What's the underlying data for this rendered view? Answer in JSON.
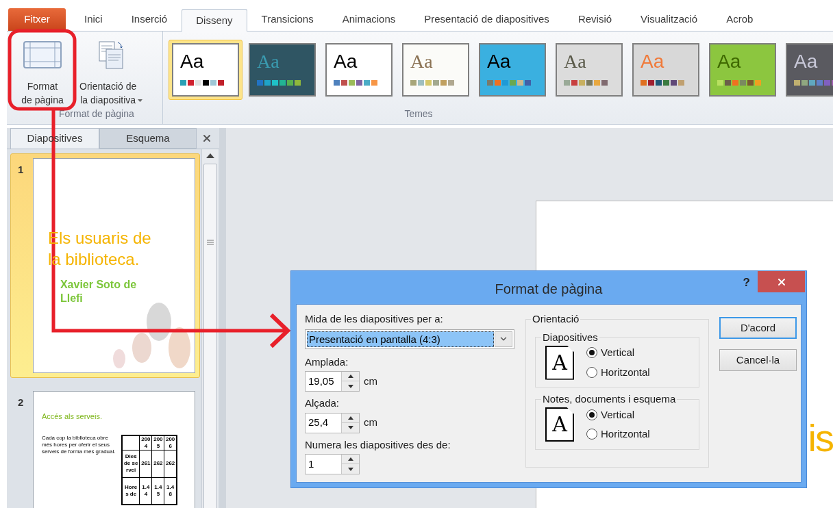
{
  "tabs": [
    {
      "label": "Fitxer",
      "kind": "file",
      "selected": false
    },
    {
      "label": "Inici",
      "kind": "tab",
      "selected": false
    },
    {
      "label": "Inserció",
      "kind": "tab",
      "selected": false
    },
    {
      "label": "Disseny",
      "kind": "tab",
      "selected": true
    },
    {
      "label": "Transicions",
      "kind": "tab",
      "selected": false
    },
    {
      "label": "Animacions",
      "kind": "tab",
      "selected": false
    },
    {
      "label": "Presentació de diapositives",
      "kind": "tab",
      "selected": false
    },
    {
      "label": "Revisió",
      "kind": "tab",
      "selected": false
    },
    {
      "label": "Visualització",
      "kind": "tab",
      "selected": false
    },
    {
      "label": "Acrob",
      "kind": "tab",
      "selected": false
    }
  ],
  "ribbon": {
    "page_group": {
      "label": "Format de pàgina",
      "buttons": [
        {
          "kind": "page",
          "lines": [
            "Format",
            "de pàgina"
          ],
          "dropdown": false
        },
        {
          "kind": "orientation",
          "lines": [
            "Orientació de",
            "la diapositiva"
          ],
          "dropdown": true
        }
      ]
    },
    "themes_group": {
      "label": "Temes",
      "themes": [
        {
          "sample": "Aa",
          "kind": "office",
          "selected": true
        },
        {
          "sample": "Aa",
          "kind": "teal",
          "selected": false
        },
        {
          "sample": "Aa",
          "kind": "plain",
          "selected": false
        },
        {
          "sample": "Aa",
          "kind": "paper",
          "selected": false
        },
        {
          "sample": "Aa",
          "kind": "diagonal",
          "selected": false
        },
        {
          "sample": "Aa",
          "kind": "gray",
          "selected": false
        },
        {
          "sample": "Aa",
          "kind": "sunset",
          "selected": false
        },
        {
          "sample": "Aa",
          "kind": "green",
          "selected": false
        },
        {
          "sample": "Aa",
          "kind": "dark",
          "selected": false
        }
      ]
    }
  },
  "slides_pane": {
    "tabs": [
      {
        "label": "Diapositives",
        "selected": true
      },
      {
        "label": "Esquema",
        "selected": false
      }
    ],
    "slides": [
      {
        "number": "1",
        "kind": "title",
        "selected": true,
        "title_lines": [
          "Els usuaris de",
          "la biblioteca."
        ],
        "subtitle_lines": [
          "Xavier Soto de",
          "Llefi"
        ]
      },
      {
        "number": "2",
        "kind": "content",
        "selected": false,
        "title": "Accés als serveis.",
        "bullet": "Cada cop la biblioteca obre més hores per oferir el seus serveis de forma més gradual.",
        "table": {
          "header": [
            "2004",
            "2005",
            "2006"
          ],
          "rows": [
            {
              "label": "Dies de servei",
              "values": [
                "261",
                "262",
                "262"
              ]
            },
            {
              "label": "Hores de",
              "values": [
                "1.44",
                "1.45",
                "1.48"
              ]
            }
          ]
        }
      }
    ]
  },
  "slide_preview": {
    "title_fragment": "is"
  },
  "dialog": {
    "title": "Format de pàgina",
    "help": "?",
    "size_label": "Mida de les diapositives per a:",
    "size_value": "Presentació en pantalla (4:3)",
    "width_label": "Amplada:",
    "width_value": "19,05",
    "width_unit": "cm",
    "height_label": "Alçada:",
    "height_value": "25,4",
    "height_unit": "cm",
    "numbering_label": "Numera les diapositives des de:",
    "numbering_value": "1",
    "orientation": {
      "label": "Orientació",
      "groups": [
        {
          "label": "Diapositives",
          "icon_letter": "A",
          "options": [
            {
              "label": "Vertical",
              "selected": true
            },
            {
              "label": "Horitzontal",
              "selected": false
            }
          ]
        },
        {
          "label": "Notes, documents i esquema",
          "icon_letter": "A",
          "options": [
            {
              "label": "Vertical",
              "selected": true
            },
            {
              "label": "Horitzontal",
              "selected": false
            }
          ]
        }
      ]
    },
    "buttons": [
      {
        "label": "D'acord",
        "default": true
      },
      {
        "label": "Cancel·la",
        "default": false
      }
    ]
  }
}
